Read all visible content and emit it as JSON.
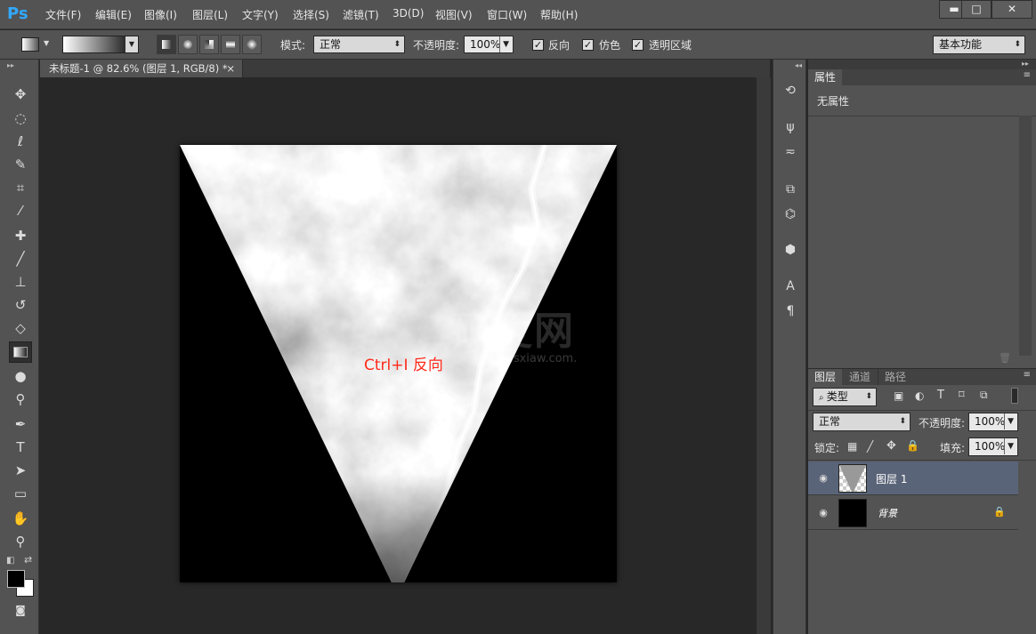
{
  "app": {
    "logo": "Ps"
  },
  "menu": [
    "文件(F)",
    "编辑(E)",
    "图像(I)",
    "图层(L)",
    "文字(Y)",
    "选择(S)",
    "滤镜(T)",
    "3D(D)",
    "视图(V)",
    "窗口(W)",
    "帮助(H)"
  ],
  "window_controls": {
    "minimize": "▬",
    "maximize": "□",
    "close": "✕"
  },
  "options": {
    "mode_label": "模式:",
    "mode_value": "正常",
    "opacity_label": "不透明度:",
    "opacity_value": "100%",
    "reverse_label": "反向",
    "dither_label": "仿色",
    "transparency_label": "透明区域",
    "workspace": "基本功能"
  },
  "document": {
    "tab_title": "未标题-1 @ 82.6% (图层 1, RGB/8) *",
    "tab_close": "×"
  },
  "canvas": {
    "annotation": "Ctrl+I 反向",
    "watermark": "硕夏网",
    "watermark_url": "www.sxiaw.com."
  },
  "properties_panel": {
    "tab": "属性",
    "content": "无属性"
  },
  "layers_panel": {
    "tabs": [
      "图层",
      "通道",
      "路径"
    ],
    "filter_kind": "类型",
    "blend_mode": "正常",
    "opacity_label": "不透明度:",
    "opacity_value": "100%",
    "lock_label": "锁定:",
    "fill_label": "填充:",
    "fill_value": "100%",
    "layers": [
      {
        "name": "图层 1",
        "selected": true
      },
      {
        "name": "背景",
        "selected": false,
        "locked": true
      }
    ]
  },
  "colors": {
    "ui_bg": "#535353",
    "canvas_bg": "#282828",
    "selection": "#5a6478",
    "annotation": "#ff2a1a",
    "ps_blue": "#31a8ff"
  }
}
